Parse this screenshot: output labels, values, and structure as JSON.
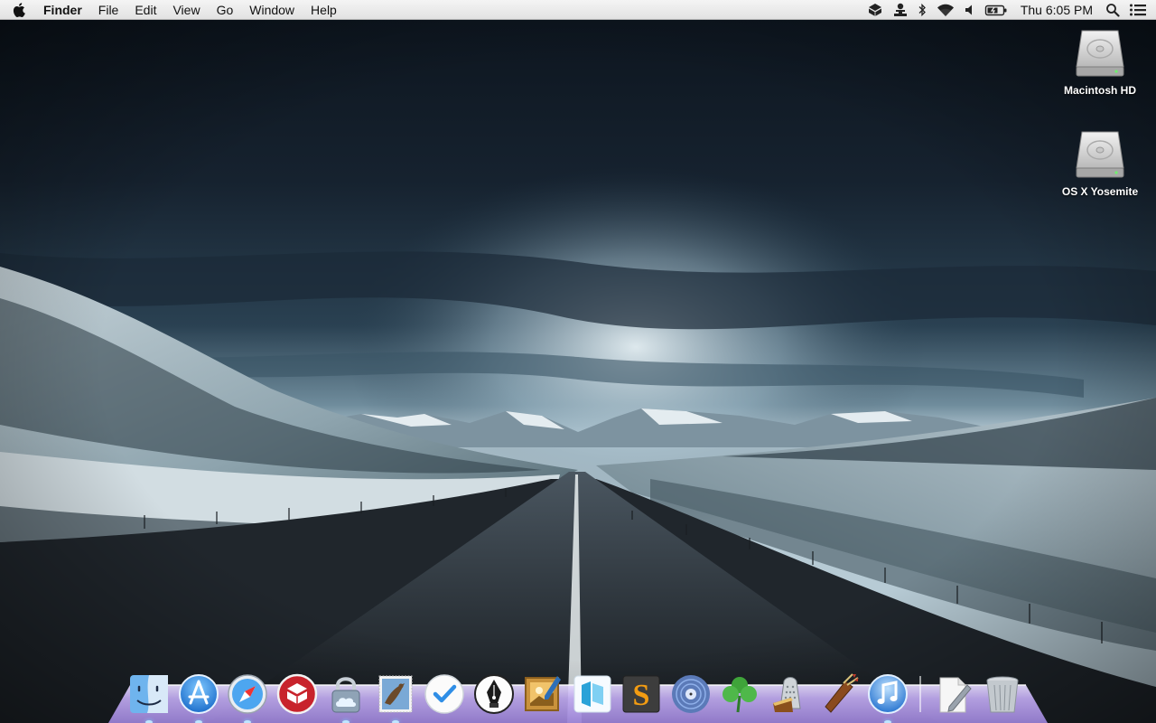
{
  "menubar": {
    "app_name": "Finder",
    "menus": [
      "File",
      "Edit",
      "View",
      "Go",
      "Window",
      "Help"
    ],
    "clock": "Thu 6:05 PM",
    "status_icons": [
      "dropbox-icon",
      "user-icon",
      "bluetooth-icon",
      "wifi-icon",
      "volume-icon",
      "battery-icon"
    ]
  },
  "desktop": {
    "drives": [
      {
        "label": "Macintosh HD",
        "icon": "hard-drive-icon"
      },
      {
        "label": "OS X Yosemite",
        "icon": "hard-drive-icon"
      }
    ]
  },
  "dock": {
    "apps": [
      {
        "icon": "finder-icon",
        "running": true
      },
      {
        "icon": "app-store-icon",
        "running": true
      },
      {
        "icon": "safari-icon",
        "running": true
      },
      {
        "icon": "cube-app-icon",
        "running": false
      },
      {
        "icon": "cloud-lock-icon",
        "running": true
      },
      {
        "icon": "mail-stamp-icon",
        "running": true
      },
      {
        "icon": "checkmark-icon",
        "running": false
      },
      {
        "icon": "fountain-pen-icon",
        "running": false
      },
      {
        "icon": "preview-frame-icon",
        "running": false
      },
      {
        "icon": "layers-app-icon",
        "running": false
      },
      {
        "icon": "sketch-s-icon",
        "running": false
      },
      {
        "icon": "vinyl-disc-icon",
        "running": false
      },
      {
        "icon": "clover-leaf-icon",
        "running": false
      },
      {
        "icon": "cheese-grater-icon",
        "running": false
      },
      {
        "icon": "quiver-icon",
        "running": false
      },
      {
        "icon": "itunes-icon",
        "running": true
      }
    ],
    "docs": [
      {
        "icon": "document-pen-icon",
        "running": false
      },
      {
        "icon": "trash-icon",
        "running": false
      }
    ]
  },
  "colors": {
    "sky_top": "#0e1620",
    "sky_glow": "#c9dbe4",
    "snow": "#a9bcc4",
    "road": "#1d2228",
    "dock_shelf": "#b7a3e6"
  }
}
